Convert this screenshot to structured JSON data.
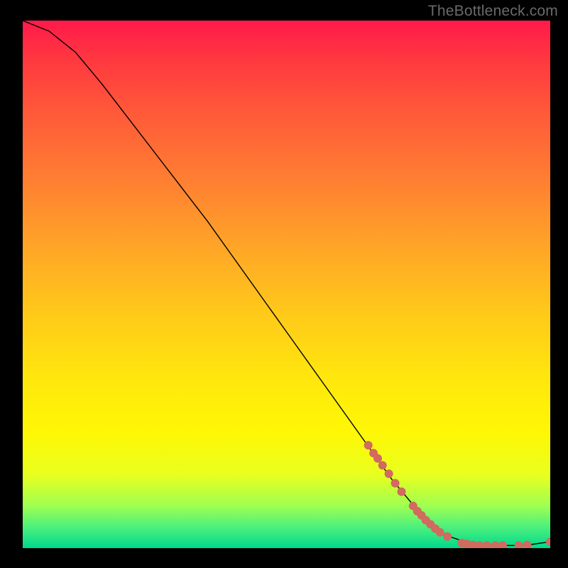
{
  "watermark": "TheBottleneck.com",
  "chart_data": {
    "type": "line",
    "title": "",
    "xlabel": "",
    "ylabel": "",
    "xlim": [
      0,
      100
    ],
    "ylim": [
      0,
      100
    ],
    "curve": [
      {
        "x": 0,
        "y": 100
      },
      {
        "x": 5,
        "y": 98
      },
      {
        "x": 10,
        "y": 94
      },
      {
        "x": 15,
        "y": 88
      },
      {
        "x": 20,
        "y": 81.5
      },
      {
        "x": 25,
        "y": 75
      },
      {
        "x": 30,
        "y": 68.5
      },
      {
        "x": 35,
        "y": 62
      },
      {
        "x": 40,
        "y": 55
      },
      {
        "x": 45,
        "y": 48
      },
      {
        "x": 50,
        "y": 41
      },
      {
        "x": 55,
        "y": 34
      },
      {
        "x": 60,
        "y": 27
      },
      {
        "x": 65,
        "y": 20
      },
      {
        "x": 70,
        "y": 13
      },
      {
        "x": 75,
        "y": 7
      },
      {
        "x": 80,
        "y": 2.5
      },
      {
        "x": 85,
        "y": 0.8
      },
      {
        "x": 90,
        "y": 0.5
      },
      {
        "x": 95,
        "y": 0.5
      },
      {
        "x": 100,
        "y": 1.2
      }
    ],
    "series": [
      {
        "name": "markers",
        "color": "#d16a5f",
        "points": [
          {
            "x": 65.5,
            "y": 19.5
          },
          {
            "x": 66.5,
            "y": 18.0
          },
          {
            "x": 67.3,
            "y": 17.0
          },
          {
            "x": 68.2,
            "y": 15.7
          },
          {
            "x": 69.4,
            "y": 14.1
          },
          {
            "x": 70.6,
            "y": 12.3
          },
          {
            "x": 71.8,
            "y": 10.7
          },
          {
            "x": 74.0,
            "y": 8.0
          },
          {
            "x": 74.8,
            "y": 7.0
          },
          {
            "x": 75.6,
            "y": 6.2
          },
          {
            "x": 76.4,
            "y": 5.3
          },
          {
            "x": 77.3,
            "y": 4.5
          },
          {
            "x": 78.2,
            "y": 3.7
          },
          {
            "x": 79.1,
            "y": 3.0
          },
          {
            "x": 80.5,
            "y": 2.2
          },
          {
            "x": 83.2,
            "y": 1.0
          },
          {
            "x": 84.2,
            "y": 0.8
          },
          {
            "x": 85.4,
            "y": 0.6
          },
          {
            "x": 86.6,
            "y": 0.5
          },
          {
            "x": 88.0,
            "y": 0.5
          },
          {
            "x": 89.6,
            "y": 0.5
          },
          {
            "x": 91.0,
            "y": 0.5
          },
          {
            "x": 94.0,
            "y": 0.5
          },
          {
            "x": 95.6,
            "y": 0.6
          },
          {
            "x": 100,
            "y": 1.2
          }
        ]
      }
    ]
  }
}
